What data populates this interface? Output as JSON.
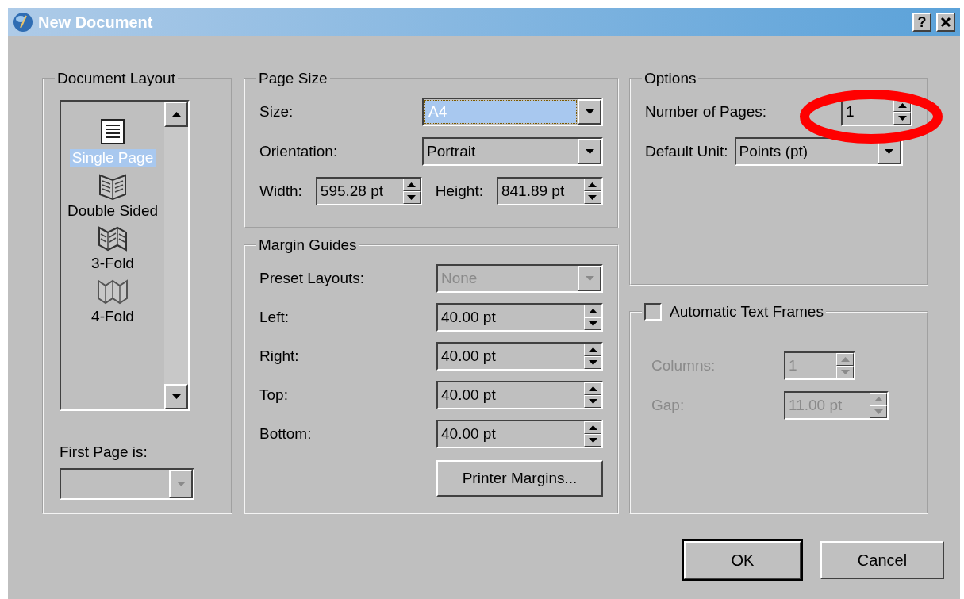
{
  "window": {
    "title": "New Document",
    "help_label": "?"
  },
  "document_layout": {
    "title": "Document Layout",
    "items": [
      {
        "label": "Single Page",
        "kind": "single",
        "selected": true
      },
      {
        "label": "Double Sided",
        "kind": "double",
        "selected": false
      },
      {
        "label": "3-Fold",
        "kind": "fold3",
        "selected": false
      },
      {
        "label": "4-Fold",
        "kind": "fold4",
        "selected": false
      }
    ],
    "first_page": {
      "label": "First Page is:",
      "disabled": true
    }
  },
  "page_size": {
    "title": "Page Size",
    "size": {
      "label": "Size:",
      "value": "A4",
      "focused": true
    },
    "orientation": {
      "label": "Orientation:",
      "value": "Portrait",
      "focused": false
    },
    "width": {
      "label": "Width:",
      "value": "595.28 pt"
    },
    "height": {
      "label": "Height:",
      "value": "841.89 pt"
    }
  },
  "margin_guides": {
    "title": "Margin Guides",
    "preset": {
      "label": "Preset Layouts:",
      "value": "None",
      "disabled": true
    },
    "fields": [
      {
        "label": "Left:",
        "value": "40.00 pt"
      },
      {
        "label": "Right:",
        "value": "40.00 pt"
      },
      {
        "label": "Top:",
        "value": "40.00 pt"
      },
      {
        "label": "Bottom:",
        "value": "40.00 pt"
      }
    ],
    "printer_button": "Printer Margins..."
  },
  "options": {
    "title": "Options",
    "pages": {
      "label": "Number of Pages:",
      "value": "1"
    },
    "unit": {
      "label": "Default Unit:",
      "value": "Points (pt)"
    }
  },
  "text_frames": {
    "label": "Automatic Text Frames",
    "checked": false,
    "columns": {
      "label": "Columns:",
      "value": "1",
      "disabled": true
    },
    "gap": {
      "label": "Gap:",
      "value": "11.00 pt",
      "disabled": true
    }
  },
  "buttons": [
    {
      "label": "OK",
      "default": true
    },
    {
      "label": "Cancel",
      "default": false
    }
  ],
  "annotation": {
    "kind": "ellipse",
    "color": "#ff0000"
  }
}
